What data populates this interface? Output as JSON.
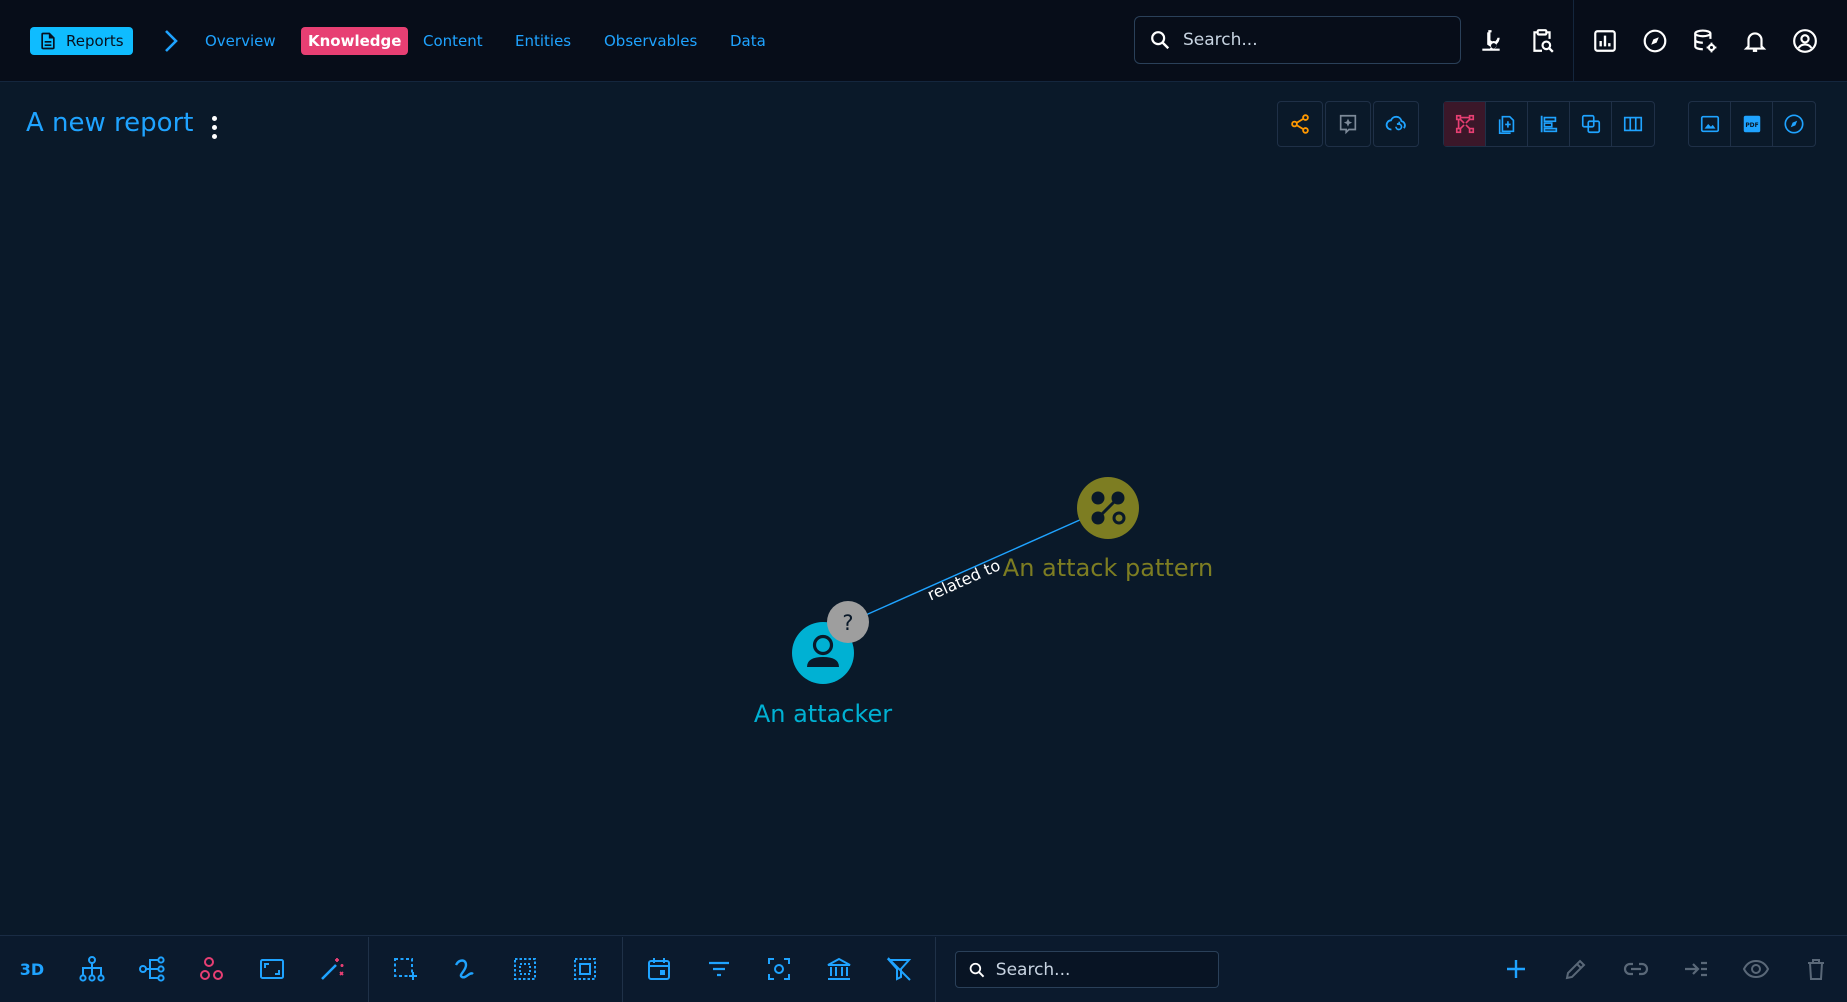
{
  "colors": {
    "accent": "#1fa3ff",
    "active_tab": "#e73f73",
    "attacker": "#00b1d3",
    "attack_pattern": "#7d7d22",
    "unknown": "#9e9e9e",
    "warning": "#ff9800"
  },
  "breadcrumb": {
    "root_label": "Reports"
  },
  "nav": {
    "tabs": [
      "Overview",
      "Knowledge",
      "Content",
      "Entities",
      "Observables",
      "Data"
    ],
    "active": "Knowledge"
  },
  "top_search": {
    "placeholder": "Search..."
  },
  "top_icons": [
    "microscope-icon",
    "clipboard-search-icon",
    "dashboard-icon",
    "compass-icon",
    "database-cog-icon",
    "bell-icon",
    "account-icon"
  ],
  "report": {
    "title": "A new report"
  },
  "view_toolbar": {
    "actions": [
      "share-icon",
      "ai-summary-icon",
      "cloud-refresh-icon"
    ],
    "views": [
      "graph-view-icon",
      "content-mapping-icon",
      "timeline-icon",
      "correlation-icon",
      "matrix-view-icon"
    ],
    "active_view": "graph-view-icon",
    "exports": [
      "image-export-icon",
      "pdf-export-icon",
      "explore-icon"
    ]
  },
  "graph": {
    "nodes": [
      {
        "label": "An attacker",
        "type": "threat-actor-individual"
      },
      {
        "label": "An attack pattern",
        "type": "attack-pattern"
      }
    ],
    "edges": [
      {
        "label": "related to",
        "marker": "?"
      }
    ]
  },
  "bottom_toolbar": {
    "mode_3d_label": "3D",
    "search_placeholder": "Search..."
  }
}
